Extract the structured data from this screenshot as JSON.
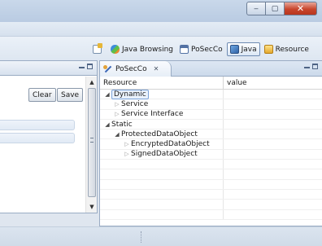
{
  "window": {
    "controls": {
      "minimize": "‒",
      "maximize": "▢",
      "close": "✕"
    }
  },
  "perspectives": [
    {
      "label": "",
      "icon": "open-perspective-icon",
      "active": false
    },
    {
      "label": "Java Browsing",
      "icon": "java-browsing-icon",
      "active": false
    },
    {
      "label": "PoSecCo",
      "icon": "posecco-perspective-icon",
      "active": false
    },
    {
      "label": "Java",
      "icon": "java-perspective-icon",
      "active": true
    },
    {
      "label": "Resource",
      "icon": "resource-perspective-icon",
      "active": false
    }
  ],
  "left_view": {
    "buttons": {
      "clear": "Clear",
      "save": "Save"
    },
    "scroll": {
      "up": "▲",
      "down": "▼"
    }
  },
  "posecco_view": {
    "tab_title": "PoSecCo",
    "tab_close": "✕",
    "columns": [
      "Resource",
      "value"
    ],
    "tree": [
      {
        "label": "Dynamic",
        "depth": 0,
        "expander": "expanded",
        "selected": true
      },
      {
        "label": "Service",
        "depth": 1,
        "expander": "collapsed",
        "selected": false
      },
      {
        "label": "Service Interface",
        "depth": 1,
        "expander": "collapsed",
        "selected": false
      },
      {
        "label": "Static",
        "depth": 0,
        "expander": "expanded",
        "selected": false
      },
      {
        "label": "ProtectedDataObject",
        "depth": 1,
        "expander": "expanded",
        "selected": false
      },
      {
        "label": "EncryptedDataObject",
        "depth": 2,
        "expander": "collapsed",
        "selected": false
      },
      {
        "label": "SignedDataObject",
        "depth": 2,
        "expander": "collapsed",
        "selected": false
      },
      {
        "label": "",
        "depth": 0,
        "expander": "none",
        "selected": false
      },
      {
        "label": "",
        "depth": 0,
        "expander": "none",
        "selected": false
      },
      {
        "label": "",
        "depth": 0,
        "expander": "none",
        "selected": false
      },
      {
        "label": "",
        "depth": 0,
        "expander": "none",
        "selected": false
      },
      {
        "label": "",
        "depth": 0,
        "expander": "none",
        "selected": false
      },
      {
        "label": "",
        "depth": 0,
        "expander": "none",
        "selected": false
      }
    ]
  },
  "icons": {
    "expanded": "◢",
    "collapsed": "▷"
  }
}
